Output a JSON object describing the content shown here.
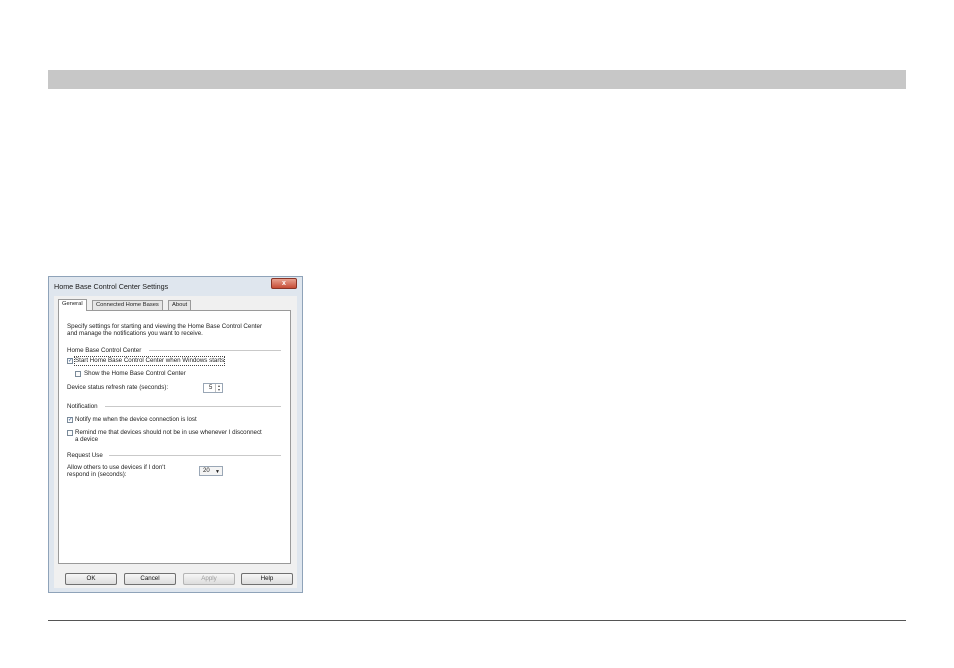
{
  "window": {
    "title": "Home Base Control Center Settings",
    "close_label": "x"
  },
  "tabs": [
    {
      "label": "General",
      "active": true
    },
    {
      "label": "Connected Home Bases",
      "active": false
    },
    {
      "label": "About",
      "active": false
    }
  ],
  "general": {
    "intro": [
      "Specify settings for starting and viewing the Home Base Control Center",
      "and manage the notifications you want to receive."
    ],
    "group_control_center": "Home Base Control Center",
    "start_with_windows": {
      "label": "Start Home Base Control Center when Windows starts",
      "checked": true
    },
    "show_control_center": {
      "label": "Show the Home Base Control Center",
      "checked": false
    },
    "refresh_rate_label": "Device status refresh rate (seconds):",
    "refresh_rate_value": "5",
    "group_notification": "Notification",
    "notify_lost": {
      "label": "Notify me when the device connection is lost",
      "checked": true
    },
    "remind_disconnect": {
      "label": [
        "Remind me that devices should not be in use whenever I disconnect",
        "a device"
      ],
      "checked": false
    },
    "group_request_use": "Request Use",
    "allow_others_label": [
      "Allow others to use devices if I don't",
      "respond in (seconds):"
    ],
    "allow_others_value": "20"
  },
  "buttons": {
    "ok": "OK",
    "cancel": "Cancel",
    "apply": "Apply",
    "help": "Help"
  }
}
